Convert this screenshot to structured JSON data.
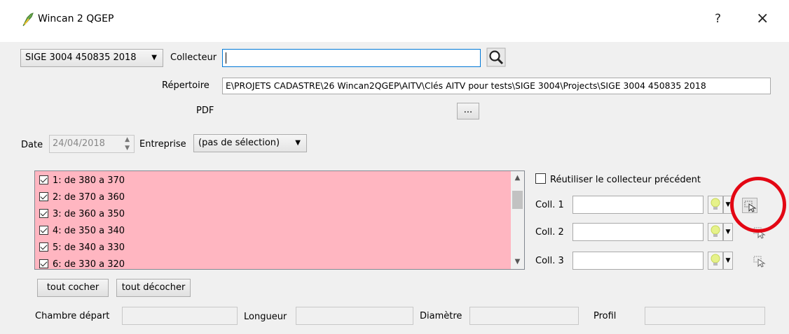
{
  "window": {
    "title": "Wincan 2 QGEP",
    "help_label": "?",
    "close_label": "×"
  },
  "top": {
    "project_select": "SIGE 3004 450835 2018",
    "collecteur_label": "Collecteur",
    "collecteur_value": "",
    "repertoire_label": "Répertoire",
    "repertoire_value": "E\\PROJETS CADASTRE\\26 Wincan2QGEP\\AITV\\Clés AITV pour tests\\SIGE 3004\\Projects\\SIGE 3004 450835 2018",
    "pdf_label": "PDF",
    "pdf_button": "..."
  },
  "meta": {
    "date_label": "Date",
    "date_value": "24/04/2018",
    "entreprise_label": "Entreprise",
    "entreprise_value": "(pas de sélection)"
  },
  "sections": [
    {
      "label": "1: de 380 a 370",
      "checked": true
    },
    {
      "label": "2: de 370 a 360",
      "checked": true
    },
    {
      "label": "3: de 360 a 350",
      "checked": true
    },
    {
      "label": "4: de 350 a 340",
      "checked": true
    },
    {
      "label": "5: de 340 a 330",
      "checked": true
    },
    {
      "label": "6: de 330 a 320",
      "checked": true
    }
  ],
  "right_panel": {
    "reuse_label": "Réutiliser le collecteur précédent",
    "colls": [
      {
        "label": "Coll. 1",
        "value": ""
      },
      {
        "label": "Coll. 2",
        "value": ""
      },
      {
        "label": "Coll. 3",
        "value": ""
      }
    ]
  },
  "actions": {
    "check_all": "tout cocher",
    "uncheck_all": "tout décocher"
  },
  "bottom": {
    "chambre_label": "Chambre départ",
    "longueur_label": "Longueur",
    "diametre_label": "Diamètre",
    "profil_label": "Profil"
  },
  "colors": {
    "list_background": "#ffb6c1",
    "highlight_ring": "#e30613",
    "focus_border": "#0078d7"
  }
}
